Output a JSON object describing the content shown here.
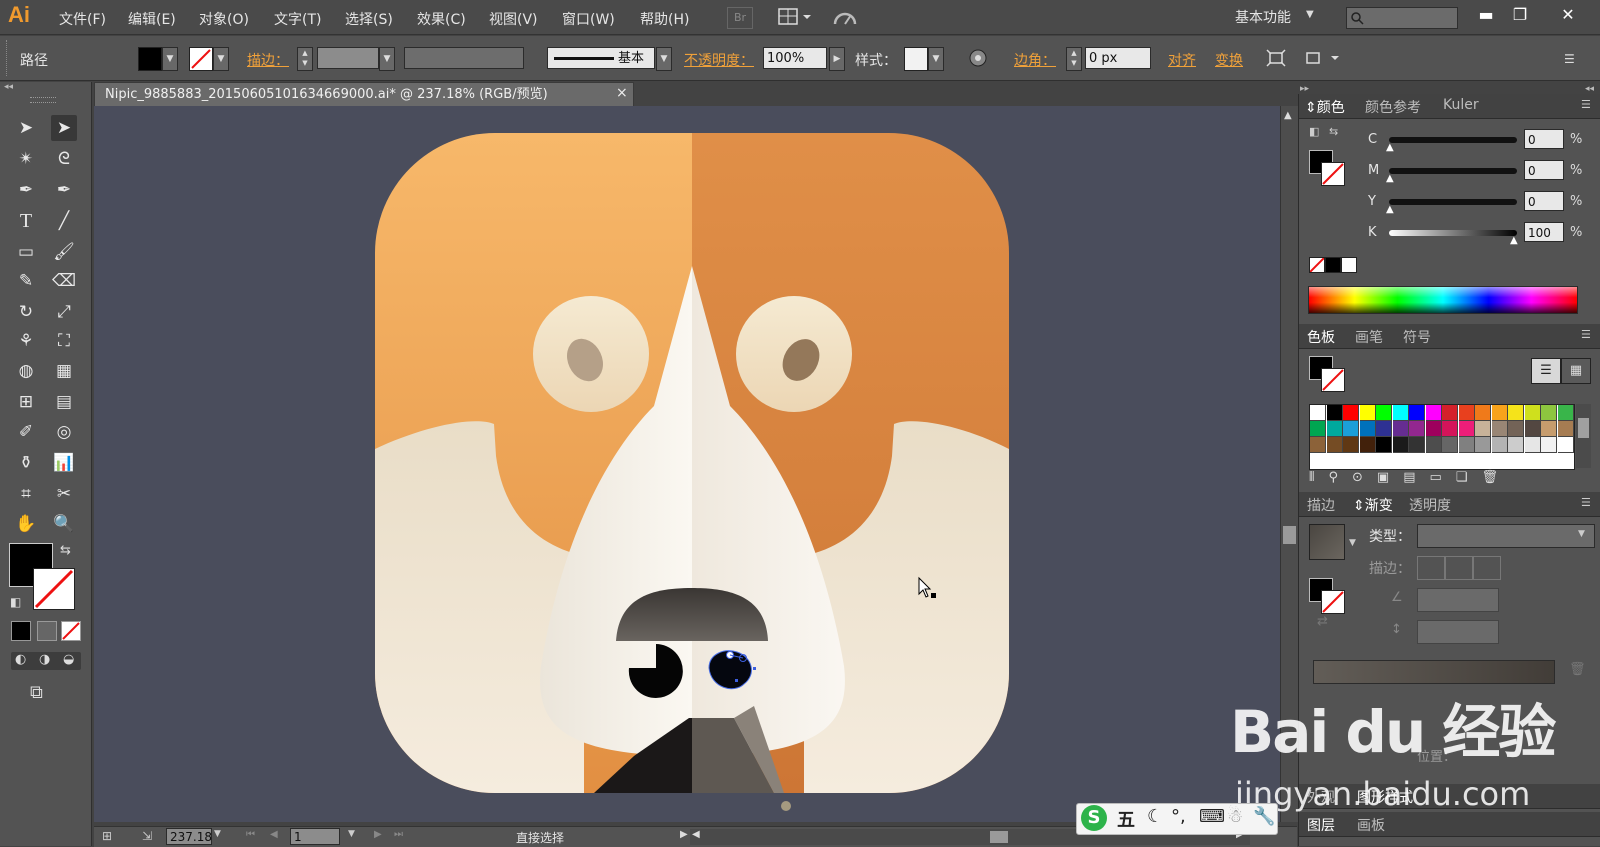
{
  "app": {
    "logo": "Ai",
    "menu": [
      "文件(F)",
      "编辑(E)",
      "对象(O)",
      "文字(T)",
      "选择(S)",
      "效果(C)",
      "视图(V)",
      "窗口(W)",
      "帮助(H)"
    ],
    "bridge_label": "Br",
    "workspace": "基本功能"
  },
  "control_bar": {
    "selection_type": "路径",
    "stroke_label": "描边：",
    "stroke_style": "基本",
    "opacity_label": "不透明度：",
    "opacity_value": "100%",
    "style_label": "样式：",
    "corner_label": "边角：",
    "corner_value": "0 px",
    "align_label": "对齐",
    "transform_label": "变换"
  },
  "document": {
    "tab_title": "Nipic_9885883_20150605101634669000.ai* @ 237.18% (RGB/预览)",
    "close_glyph": "×"
  },
  "status_bar": {
    "zoom": "237.18",
    "artboard": "1",
    "tool_name": "直接选择"
  },
  "color_panel": {
    "tabs": [
      "颜色",
      "颜色参考",
      "Kuler"
    ],
    "channels": [
      {
        "label": "C",
        "value": "0",
        "unit": "%"
      },
      {
        "label": "M",
        "value": "0",
        "unit": "%"
      },
      {
        "label": "Y",
        "value": "0",
        "unit": "%"
      },
      {
        "label": "K",
        "value": "100",
        "unit": "%"
      }
    ]
  },
  "swatches_panel": {
    "tabs": [
      "色板",
      "画笔",
      "符号"
    ],
    "colors": [
      "#ffffff",
      "#000000",
      "#ff0000",
      "#ffff00",
      "#00ff00",
      "#00ffff",
      "#0000ff",
      "#ff00ff",
      "#d4202a",
      "#e8401e",
      "#f07a1a",
      "#f8a31b",
      "#f5e31a",
      "#cfe01d",
      "#8dc63f",
      "#39b54a",
      "#00a651",
      "#00a99d",
      "#1b9fd8",
      "#0071bc",
      "#2e3192",
      "#662d91",
      "#92278f",
      "#9e005d",
      "#d4145a",
      "#ed1e79",
      "#c7b299",
      "#998675",
      "#736357",
      "#534741",
      "#c69c6d",
      "#a67c52",
      "#8c6239",
      "#754c24",
      "#603813",
      "#42210b",
      "#000000",
      "#1a1a1a",
      "#333333",
      "#4d4d4d",
      "#666666",
      "#808080",
      "#999999",
      "#b3b3b3",
      "#cccccc",
      "#e6e6e6",
      "#f2f2f2",
      "#ffffff"
    ]
  },
  "gradient_panel": {
    "tabs": [
      "描边",
      "渐变",
      "透明度"
    ],
    "type_label": "类型：",
    "stroke_label": "描边："
  },
  "bottom_panels": {
    "tabs_a": [
      "外观",
      "图形样式"
    ],
    "tabs_b": [
      "图层",
      "画板"
    ],
    "position_label": "位置："
  },
  "watermark": {
    "brand": "Bai du 经验",
    "url": "jingyan.baidu.com",
    "ime_label": "五"
  },
  "colors": {
    "accent_orange": "#f0a13a",
    "canvas_bg": "#4a4d5c",
    "dog_fur": "#e8963f",
    "dog_face": "#f3ecdf"
  }
}
